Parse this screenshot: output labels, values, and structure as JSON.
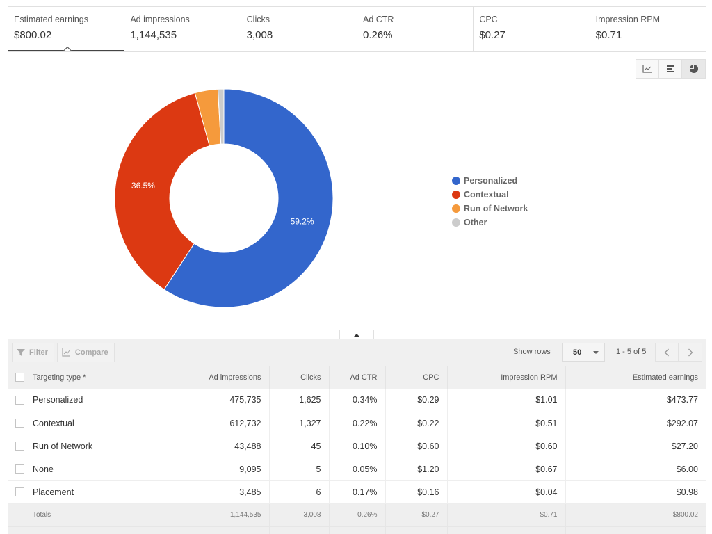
{
  "scorecards": [
    {
      "label": "Estimated earnings",
      "value": "$800.02",
      "active": true
    },
    {
      "label": "Ad impressions",
      "value": "1,144,535",
      "active": false
    },
    {
      "label": "Clicks",
      "value": "3,008",
      "active": false
    },
    {
      "label": "Ad CTR",
      "value": "0.26%",
      "active": false
    },
    {
      "label": "CPC",
      "value": "$0.27",
      "active": false
    },
    {
      "label": "Impression RPM",
      "value": "$0.71",
      "active": false
    }
  ],
  "chart_toggle": {
    "options": [
      "line-chart-icon",
      "bar-chart-icon",
      "pie-chart-icon"
    ],
    "selected": "pie-chart-icon"
  },
  "chart_data": {
    "type": "pie",
    "variant": "donut",
    "title": "",
    "metric": "Estimated earnings",
    "categories": [
      "Personalized",
      "Contextual",
      "Run of Network",
      "Other"
    ],
    "values": [
      473.77,
      292.07,
      27.2,
      6.98
    ],
    "percent_labels": [
      "59.2%",
      "36.5%",
      "",
      ""
    ],
    "colors": [
      "#3366cc",
      "#dc3912",
      "#f59a3c",
      "#cccccc"
    ],
    "legend": {
      "position": "right",
      "entries": [
        "Personalized",
        "Contextual",
        "Run of Network",
        "Other"
      ]
    }
  },
  "table": {
    "toolbar": {
      "filter_label": "Filter",
      "compare_label": "Compare",
      "show_rows_label": "Show rows",
      "show_rows_value": "50",
      "page_info": "1 - 5 of 5"
    },
    "columns": [
      "Targeting type *",
      "Ad impressions",
      "Clicks",
      "Ad CTR",
      "CPC",
      "Impression RPM",
      "Estimated earnings"
    ],
    "rows": [
      [
        "Personalized",
        "475,735",
        "1,625",
        "0.34%",
        "$0.29",
        "$1.01",
        "$473.77"
      ],
      [
        "Contextual",
        "612,732",
        "1,327",
        "0.22%",
        "$0.22",
        "$0.51",
        "$292.07"
      ],
      [
        "Run of Network",
        "43,488",
        "45",
        "0.10%",
        "$0.60",
        "$0.60",
        "$27.20"
      ],
      [
        "None",
        "9,095",
        "5",
        "0.05%",
        "$1.20",
        "$0.67",
        "$6.00"
      ],
      [
        "Placement",
        "3,485",
        "6",
        "0.17%",
        "$0.16",
        "$0.04",
        "$0.98"
      ]
    ],
    "totals": [
      "Totals",
      "1,144,535",
      "3,008",
      "0.26%",
      "$0.27",
      "$0.71",
      "$800.02"
    ]
  }
}
